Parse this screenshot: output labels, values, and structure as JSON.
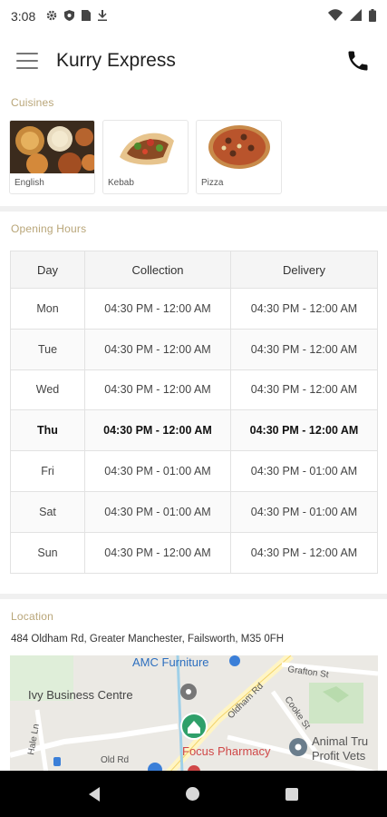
{
  "status_bar": {
    "time": "3:08",
    "icons": [
      "gear-icon",
      "shield-icon",
      "sim-card-icon",
      "download-icon"
    ],
    "right_icons": [
      "wifi-icon",
      "signal-icon",
      "battery-icon"
    ]
  },
  "app_bar": {
    "title": "Kurry Express",
    "menu_icon": "hamburger-menu-icon",
    "call_icon": "phone-icon"
  },
  "cuisines": {
    "label": "Cuisines",
    "items": [
      {
        "label": "English"
      },
      {
        "label": "Kebab"
      },
      {
        "label": "Pizza"
      }
    ]
  },
  "hours": {
    "label": "Opening Hours",
    "headers": [
      "Day",
      "Collection",
      "Delivery"
    ],
    "rows": [
      {
        "day": "Mon",
        "collection": "04:30 PM - 12:00 AM",
        "delivery": "04:30 PM - 12:00 AM"
      },
      {
        "day": "Tue",
        "collection": "04:30 PM - 12:00 AM",
        "delivery": "04:30 PM - 12:00 AM"
      },
      {
        "day": "Wed",
        "collection": "04:30 PM - 12:00 AM",
        "delivery": "04:30 PM - 12:00 AM"
      },
      {
        "day": "Thu",
        "collection": "04:30 PM - 12:00 AM",
        "delivery": "04:30 PM - 12:00 AM"
      },
      {
        "day": "Fri",
        "collection": "04:30 PM - 01:00 AM",
        "delivery": "04:30 PM - 01:00 AM"
      },
      {
        "day": "Sat",
        "collection": "04:30 PM - 01:00 AM",
        "delivery": "04:30 PM - 01:00 AM"
      },
      {
        "day": "Sun",
        "collection": "04:30 PM - 12:00 AM",
        "delivery": "04:30 PM - 12:00 AM"
      }
    ],
    "today": "Thu"
  },
  "location": {
    "label": "Location",
    "address": "484 Oldham Rd, Greater Manchester, Failsworth, M35 0FH",
    "map": {
      "places": [
        "AMC Furniture",
        "Ivy Business Centre",
        "Focus Pharmacy",
        "Animal Tru",
        "Profit Vets"
      ],
      "streets": [
        "Oldham Rd",
        "Grafton St",
        "Cooke St",
        "Hale Ln",
        "Old Rd"
      ]
    }
  },
  "nav_bar": {
    "buttons": [
      "back-icon",
      "home-icon",
      "recents-icon"
    ]
  }
}
